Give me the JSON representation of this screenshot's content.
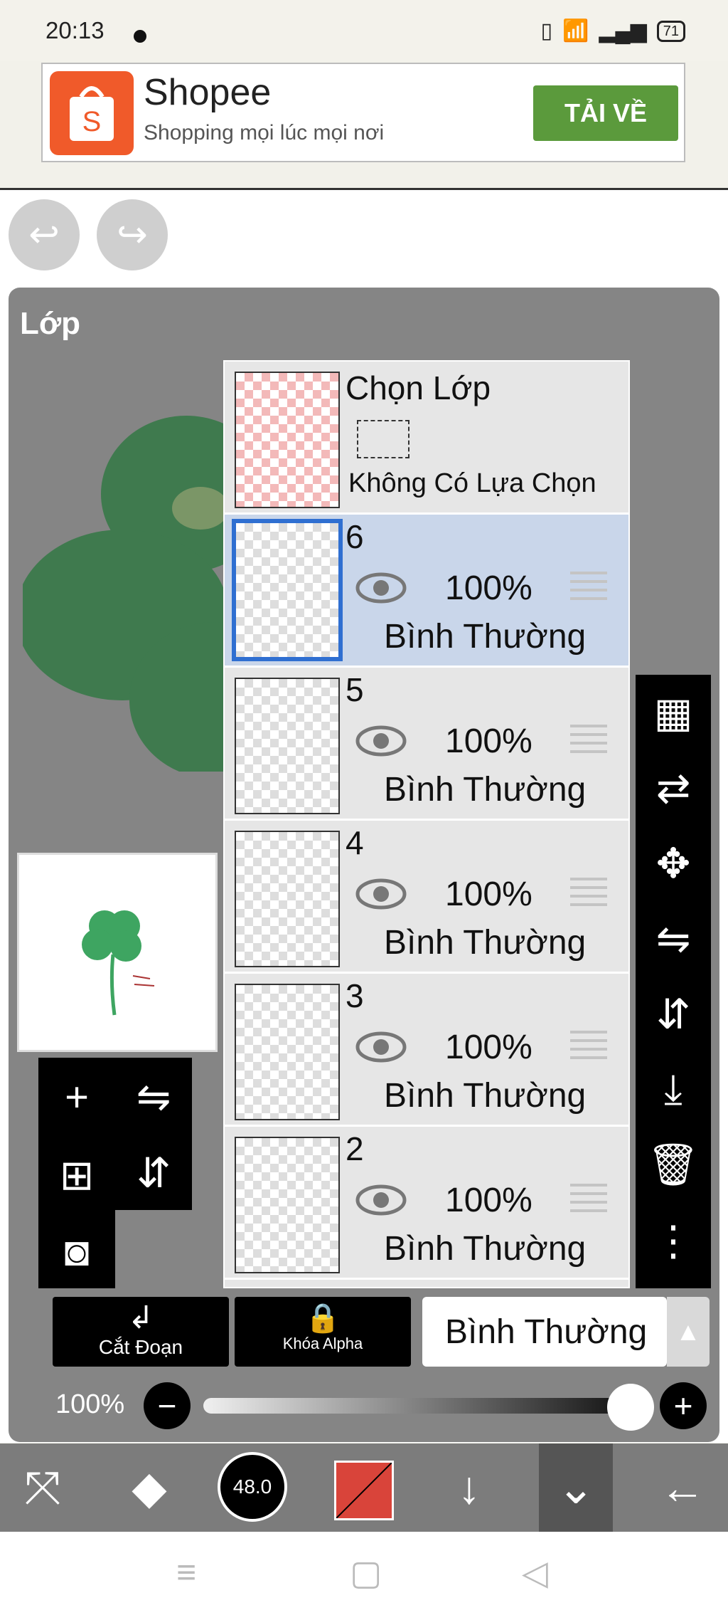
{
  "status": {
    "time": "20:13",
    "battery": "71"
  },
  "ad": {
    "title": "Shopee",
    "subtitle": "Shopping mọi lúc mọi nơi",
    "cta": "TẢI VỀ",
    "brand_color": "#f05a2a",
    "cta_color": "#5b9a3c"
  },
  "panel": {
    "title": "Lớp"
  },
  "selection": {
    "title": "Chọn Lớp",
    "value": "Không Có Lựa Chọn"
  },
  "layers": [
    {
      "num": "6",
      "opacity": "100%",
      "mode": "Bình Thường",
      "selected": true
    },
    {
      "num": "5",
      "opacity": "100%",
      "mode": "Bình Thường"
    },
    {
      "num": "4",
      "opacity": "100%",
      "mode": "Bình Thường"
    },
    {
      "num": "3",
      "opacity": "100%",
      "mode": "Bình Thường"
    },
    {
      "num": "2",
      "opacity": "100%",
      "mode": "Bình Thường"
    }
  ],
  "buttons": {
    "clipping": "Cắt Đoạn",
    "alpha_lock": "Khóa Alpha"
  },
  "blend_mode": "Bình Thường",
  "opacity": {
    "label": "100%",
    "value": 1.0
  },
  "brush_size": "48.0",
  "active_color": "#d9443a",
  "icons": [
    "undo-icon",
    "redo-icon",
    "eye-icon",
    "drag-handle-icon",
    "checker-icon",
    "move-icon",
    "flip-icon",
    "merge-down-icon",
    "trash-icon",
    "more-icon",
    "add-layer-icon",
    "camera-icon",
    "eraser-icon",
    "brush-icon",
    "arrow-down-icon",
    "chevron-down-icon",
    "back-arrow-icon"
  ]
}
